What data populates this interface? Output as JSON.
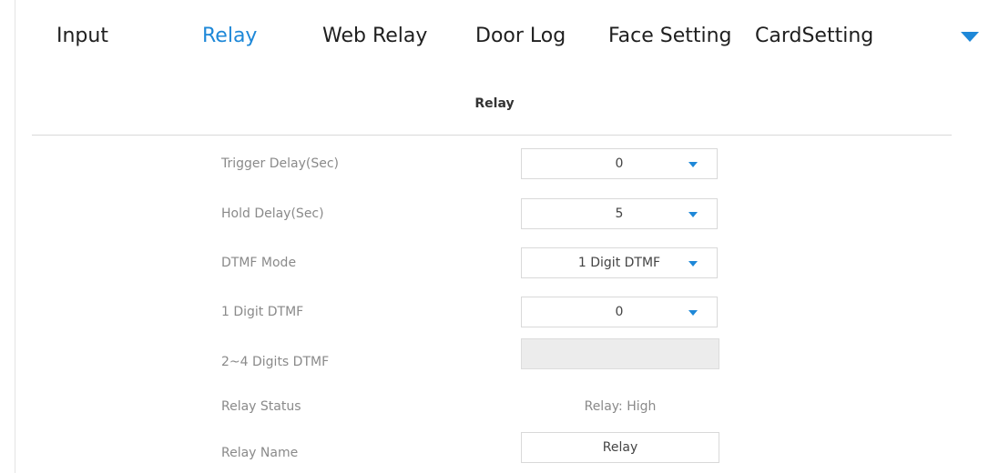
{
  "tabs": [
    {
      "label": "Input",
      "active": false
    },
    {
      "label": "Relay",
      "active": true
    },
    {
      "label": "Web Relay",
      "active": false
    },
    {
      "label": "Door Log",
      "active": false
    },
    {
      "label": "Face Setting",
      "active": false
    },
    {
      "label": "CardSetting",
      "active": false
    }
  ],
  "tabs_more_icon": "caret-down-icon",
  "section": {
    "title": "Relay"
  },
  "fields": {
    "trigger_delay": {
      "label": "Trigger Delay(Sec)",
      "value": "0"
    },
    "hold_delay": {
      "label": "Hold Delay(Sec)",
      "value": "5"
    },
    "dtmf_mode": {
      "label": "DTMF Mode",
      "value": "1 Digit DTMF"
    },
    "one_digit_dtmf": {
      "label": "1 Digit DTMF",
      "value": "0"
    },
    "multi_digit_dtmf": {
      "label": "2~4 Digits DTMF",
      "value": ""
    },
    "relay_status": {
      "label": "Relay Status",
      "value": "Relay: High"
    },
    "relay_name": {
      "label": "Relay Name",
      "value": "Relay"
    }
  },
  "colors": {
    "accent": "#1e88d8",
    "label": "#8a8a8a",
    "border": "#d9d9d9",
    "disabled_bg": "#ececec"
  }
}
